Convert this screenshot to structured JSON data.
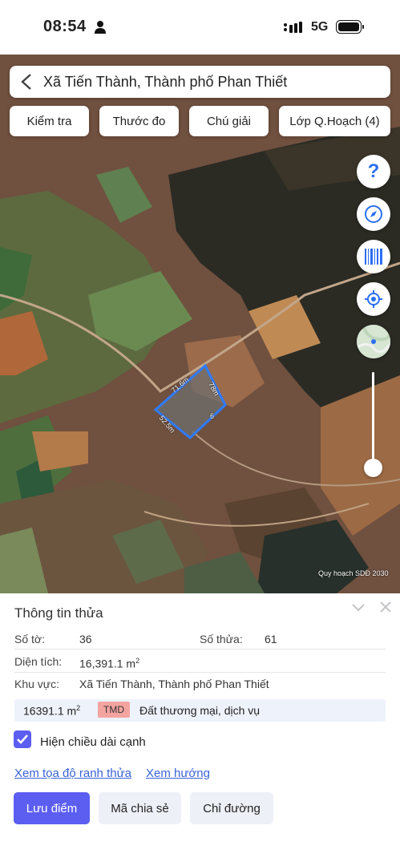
{
  "status_bar": {
    "time": "08:54",
    "network": "5G",
    "icons": [
      "person-icon",
      "signal-icon",
      "battery-icon"
    ]
  },
  "search": {
    "back_icon": "chevron-left-icon",
    "location": "Xã Tiến Thành, Thành phố Phan Thiết"
  },
  "toolbar": {
    "check_label": "Kiểm tra",
    "measure_label": "Thước đo",
    "legend_label": "Chú giải",
    "planning_layer_label": "Lớp Q.Hoạch (4)"
  },
  "map_controls": {
    "help_text": "?",
    "icons": [
      "help-icon",
      "compass-icon",
      "barcode-icon",
      "locate-icon",
      "minimap-icon"
    ]
  },
  "map": {
    "parcel_edges": [
      "71.6m",
      "78m",
      "52.5m",
      "6"
    ],
    "watermark": "Quy hoạch SDĐ 2030"
  },
  "panel": {
    "title": "Thông tin thửa",
    "sheet_label": "Số tờ:",
    "sheet_value": "36",
    "parcel_label": "Số thửa:",
    "parcel_value": "61",
    "area_label": "Diện tích:",
    "area_value": "16,391.1 m",
    "area_unit_sup": "2",
    "region_label": "Khu vực:",
    "region_value": "Xã Tiến Thành, Thành phố Phan Thiết",
    "landuse_area": "16391.1 m",
    "landuse_area_sup": "2",
    "landuse_code": "TMD",
    "landuse_desc": "Đất thương mại, dịch vụ",
    "show_edges_label": "Hiện chiều dài cạnh",
    "show_edges_checked": true,
    "link_boundary": "Xem tọa độ ranh thửa",
    "link_direction": "Xem hướng",
    "btn_save": "Lưu điểm",
    "btn_share": "Mã chia sẻ",
    "btn_route": "Chỉ đường"
  },
  "colors": {
    "accent": "#5b5ef0",
    "link": "#3b63d6",
    "parcel_outline": "#2f7bff",
    "tmd_badge": "#f4a4a0"
  }
}
